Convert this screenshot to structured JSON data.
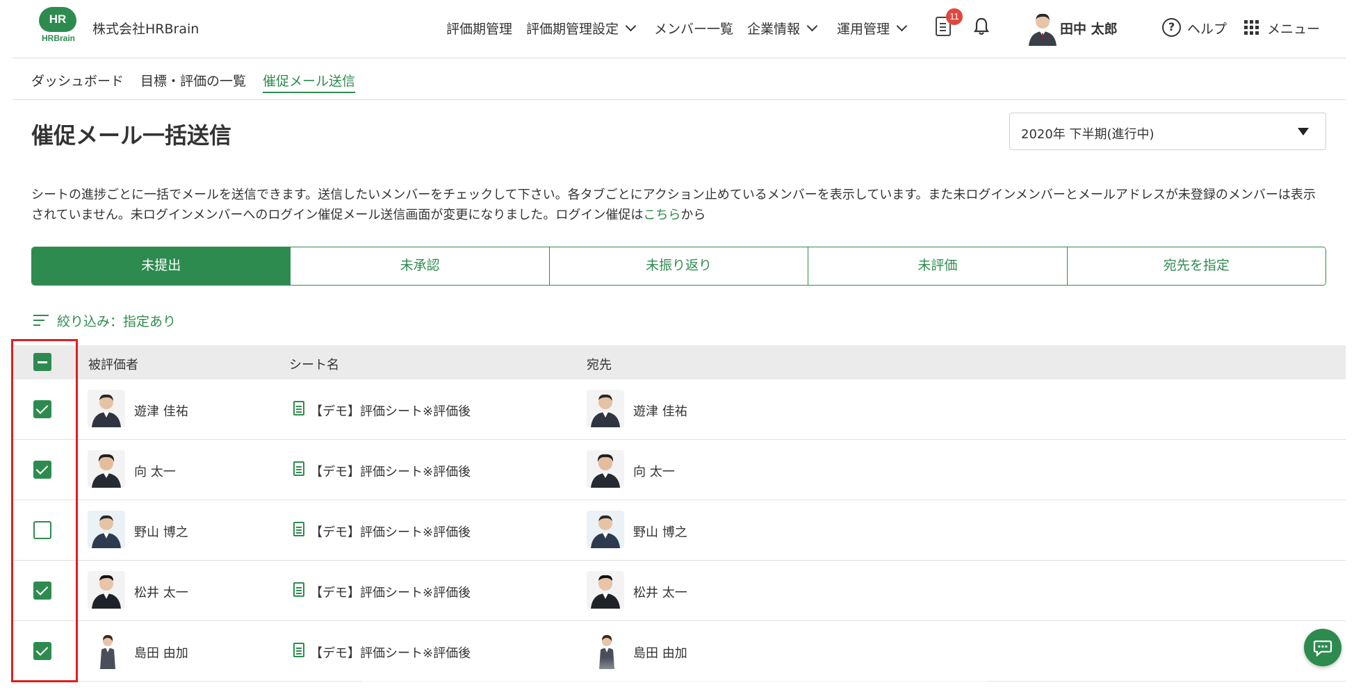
{
  "header": {
    "logo_text": "HR",
    "logo_sub": "HRBrain",
    "company": "株式会社HRBrain",
    "nav": [
      {
        "label": "評価期管理",
        "dropdown": false
      },
      {
        "label": "評価期管理設定",
        "dropdown": true
      },
      {
        "label": "メンバー一覧",
        "dropdown": false
      },
      {
        "label": "企業情報",
        "dropdown": true
      },
      {
        "label": "運用管理",
        "dropdown": true
      }
    ],
    "notification_count": "11",
    "user_name": "田中 太郎",
    "help_label": "ヘルプ",
    "help_icon_glyph": "?",
    "menu_label": "メニュー"
  },
  "breadcrumb": [
    "ダッシュボード",
    "目標・評価の一覧",
    "催促メール送信"
  ],
  "page": {
    "title": "催促メール一括送信",
    "period": "2020年 下半期(進行中)",
    "description_text": "シートの進捗ごとに一括でメールを送信できます。送信したいメンバーをチェックして下さい。各タブごとにアクション止めているメンバーを表示しています。また未ログインメンバーとメールアドレスが未登録のメンバーは表示されていません。未ログインメンバーへのログイン催促メール送信画面が変更になりました。ログイン催促は",
    "description_link": "こちら",
    "description_suffix": "から"
  },
  "tabs": [
    {
      "label": "未提出",
      "active": true
    },
    {
      "label": "未承認",
      "active": false
    },
    {
      "label": "未振り返り",
      "active": false
    },
    {
      "label": "未評価",
      "active": false
    },
    {
      "label": "宛先を指定",
      "active": false
    }
  ],
  "filter_label": "絞り込み：指定あり",
  "table": {
    "headers": [
      "被評価者",
      "シート名",
      "宛先"
    ],
    "select_all_state": "indeterminate",
    "rows": [
      {
        "checked": true,
        "evaluatee": "遊津 佳祐",
        "sheet": "【デモ】評価シート※評価後",
        "recipient": "遊津 佳祐"
      },
      {
        "checked": true,
        "evaluatee": "向 太一",
        "sheet": "【デモ】評価シート※評価後",
        "recipient": "向 太一"
      },
      {
        "checked": false,
        "evaluatee": "野山 博之",
        "sheet": "【デモ】評価シート※評価後",
        "recipient": "野山 博之"
      },
      {
        "checked": true,
        "evaluatee": "松井 太一",
        "sheet": "【デモ】評価シート※評価後",
        "recipient": "松井 太一"
      },
      {
        "checked": true,
        "evaluatee": "島田 由加",
        "sheet": "【デモ】評価シート※評価後",
        "recipient": "島田 由加"
      }
    ]
  },
  "colors": {
    "brand": "#2e8b4f",
    "highlight": "#e01e1e",
    "badge": "#e0483e"
  }
}
